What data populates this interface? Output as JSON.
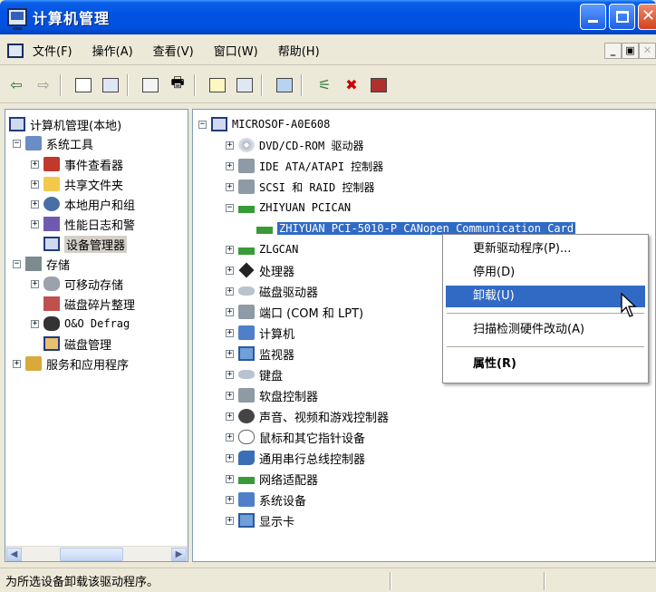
{
  "window": {
    "title": "计算机管理"
  },
  "menubar": {
    "items": [
      "文件(F)",
      "操作(A)",
      "查看(V)",
      "窗口(W)",
      "帮助(H)"
    ]
  },
  "left_tree": {
    "root": "计算机管理(本地)",
    "system_tools": "系统工具",
    "event_viewer": "事件查看器",
    "shared_folders": "共享文件夹",
    "local_users": "本地用户和组",
    "perf_logs": "性能日志和警",
    "device_manager": "设备管理器",
    "storage": "存储",
    "removable": "可移动存储",
    "defrag": "磁盘碎片整理",
    "oo_defrag": "O&O Defrag",
    "disk_mgmt": "磁盘管理",
    "services_apps": "服务和应用程序"
  },
  "right_tree": {
    "computer": "MICROSOF-A0E608",
    "items": [
      "DVD/CD-ROM 驱动器",
      "IDE ATA/ATAPI 控制器",
      "SCSI 和 RAID 控制器",
      "ZHIYUAN PCICAN",
      "ZHIYUAN PCI-5010-P CANopen Communication Card",
      "ZLGCAN",
      "处理器",
      "磁盘驱动器",
      "端口 (COM 和 LPT)",
      "计算机",
      "监视器",
      "键盘",
      "软盘控制器",
      "声音、视频和游戏控制器",
      "鼠标和其它指针设备",
      "通用串行总线控制器",
      "网络适配器",
      "系统设备",
      "显示卡"
    ]
  },
  "context_menu": {
    "update_driver": "更新驱动程序(P)...",
    "disable": "停用(D)",
    "uninstall": "卸载(U)",
    "scan": "扫描检测硬件改动(A)",
    "properties": "属性(R)"
  },
  "status_bar": {
    "text": "为所选设备卸载该驱动程序。"
  },
  "colors": {
    "selection": "#316ac5",
    "titlebar": "#0054e3"
  }
}
